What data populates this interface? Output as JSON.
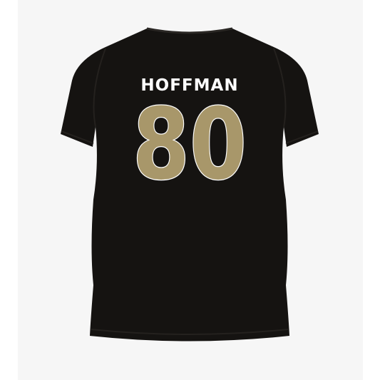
{
  "product": {
    "player_name": "HOFFMAN",
    "player_number": "80",
    "shirt_color": "#151311",
    "number_fill_color": "#a8976a",
    "number_outline_color": "#ffffff",
    "name_color": "#ffffff",
    "background_color": "#f6f6f6"
  }
}
